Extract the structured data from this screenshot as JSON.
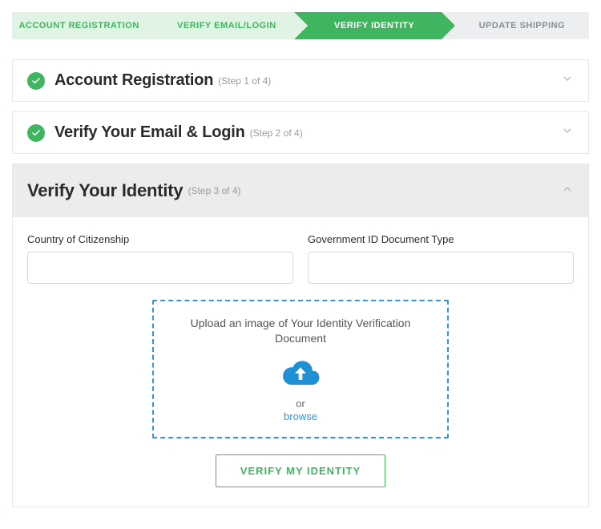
{
  "progress": {
    "steps": [
      {
        "label": "ACCOUNT REGISTRATION",
        "state": "completed"
      },
      {
        "label": "VERIFY EMAIL/LOGIN",
        "state": "completed"
      },
      {
        "label": "VERIFY IDENTITY",
        "state": "active"
      },
      {
        "label": "UPDATE SHIPPING",
        "state": "upcoming"
      }
    ]
  },
  "panels": {
    "registration": {
      "title": "Account Registration",
      "sub": "(Step 1 of 4)"
    },
    "email": {
      "title": "Verify Your Email & Login",
      "sub": "(Step 2 of 4)"
    },
    "identity": {
      "title": "Verify Your Identity",
      "sub": "(Step 3 of 4)"
    }
  },
  "form": {
    "citizenship_label": "Country of Citizenship",
    "citizenship_value": "",
    "doctype_label": "Government ID Document Type",
    "doctype_value": ""
  },
  "upload": {
    "prompt": "Upload an image of Your Identity Verification Document",
    "or": "or",
    "browse": "browse"
  },
  "actions": {
    "verify_label": "VERIFY MY IDENTITY"
  }
}
